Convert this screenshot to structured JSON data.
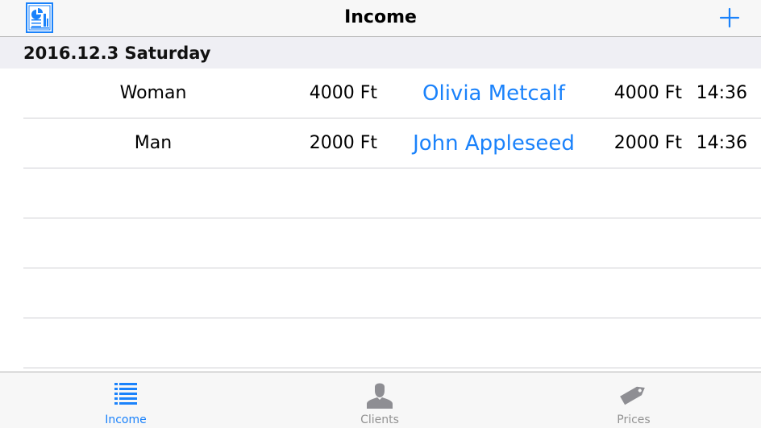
{
  "navbar": {
    "title": "Income",
    "left_icon": "report-chart-icon",
    "right_icon": "plus-icon"
  },
  "section": {
    "title": "2016.12.3 Saturday"
  },
  "rows": [
    {
      "type": "Woman",
      "price": "4000 Ft",
      "client": "Olivia Metcalf",
      "paid": "4000 Ft",
      "time": "14:36"
    },
    {
      "type": "Man",
      "price": "2000 Ft",
      "client": "John Appleseed",
      "paid": "2000 Ft",
      "time": "14:36"
    }
  ],
  "tabs": [
    {
      "label": "Income",
      "icon": "list-icon",
      "active": true
    },
    {
      "label": "Clients",
      "icon": "person-icon",
      "active": false
    },
    {
      "label": "Prices",
      "icon": "price-tag-icon",
      "active": false
    }
  ],
  "colors": {
    "accent": "#1a82fb",
    "inactive": "#929292",
    "bar_background": "#f7f7f7",
    "section_background": "#efeff4"
  }
}
